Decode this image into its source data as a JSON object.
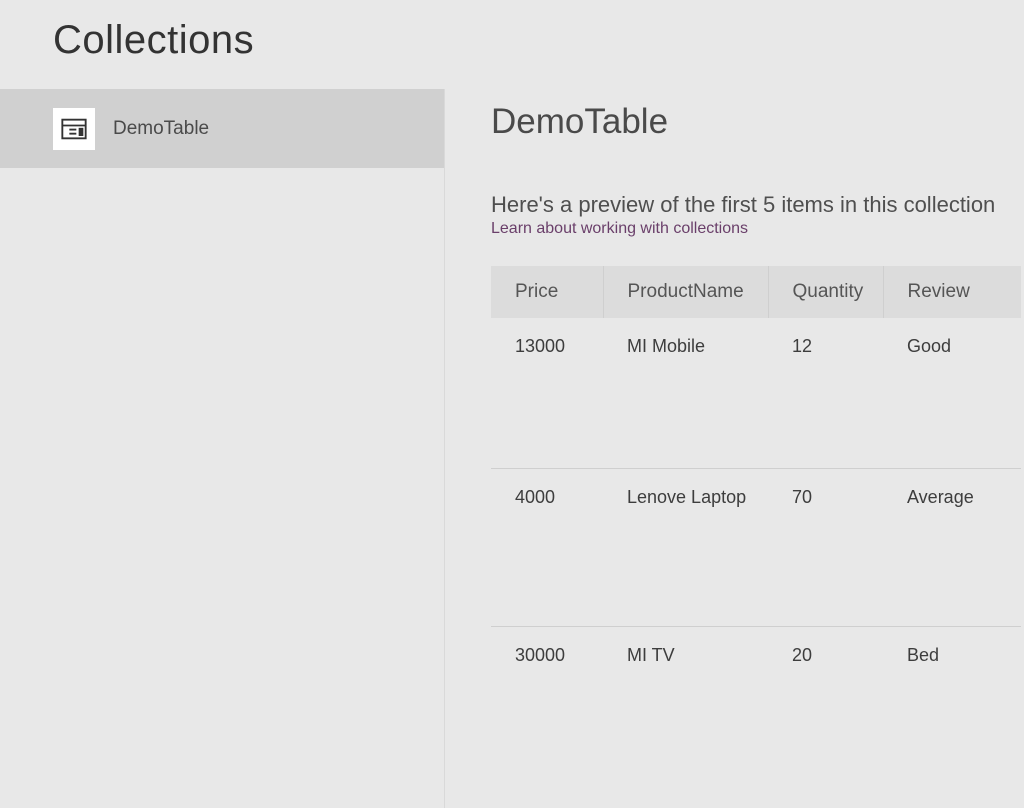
{
  "header": {
    "title": "Collections"
  },
  "sidebar": {
    "items": [
      {
        "label": "DemoTable",
        "icon": "table-icon"
      }
    ]
  },
  "main": {
    "title": "DemoTable",
    "preview_label": "Here's a preview of the first 5 items in this collection",
    "learn_link": "Learn about working with collections",
    "columns": [
      "Price",
      "ProductName",
      "Quantity",
      "Review"
    ],
    "rows": [
      {
        "Price": "13000",
        "ProductName": "MI Mobile",
        "Quantity": "12",
        "Review": "Good"
      },
      {
        "Price": "4000",
        "ProductName": "Lenove Laptop",
        "Quantity": "70",
        "Review": "Average"
      },
      {
        "Price": "30000",
        "ProductName": "MI TV",
        "Quantity": "20",
        "Review": "Bed"
      }
    ]
  }
}
